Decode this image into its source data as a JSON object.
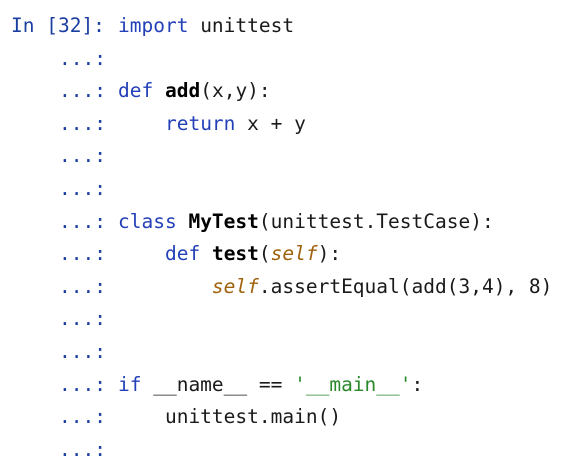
{
  "cell": {
    "in_prompt": "In [32]:",
    "cont_prompt": "...:",
    "lines": [
      {
        "tokens": [
          {
            "t": "import",
            "c": "kw"
          },
          {
            "t": " unittest",
            "c": "name"
          }
        ]
      },
      {
        "tokens": []
      },
      {
        "tokens": [
          {
            "t": "def",
            "c": "kw"
          },
          {
            "t": " ",
            "c": "name"
          },
          {
            "t": "add",
            "c": "fn"
          },
          {
            "t": "(x,y):",
            "c": "name"
          }
        ]
      },
      {
        "tokens": [
          {
            "t": "    ",
            "c": "name"
          },
          {
            "t": "return",
            "c": "kw"
          },
          {
            "t": " x + y",
            "c": "name"
          }
        ]
      },
      {
        "tokens": []
      },
      {
        "tokens": []
      },
      {
        "tokens": [
          {
            "t": "class",
            "c": "kw"
          },
          {
            "t": " ",
            "c": "name"
          },
          {
            "t": "MyTest",
            "c": "cls"
          },
          {
            "t": "(unittest.TestCase):",
            "c": "name"
          }
        ]
      },
      {
        "tokens": [
          {
            "t": "    ",
            "c": "name"
          },
          {
            "t": "def",
            "c": "kw"
          },
          {
            "t": " ",
            "c": "name"
          },
          {
            "t": "test",
            "c": "fn"
          },
          {
            "t": "(",
            "c": "name"
          },
          {
            "t": "self",
            "c": "selfkw"
          },
          {
            "t": "):",
            "c": "name"
          }
        ]
      },
      {
        "tokens": [
          {
            "t": "        ",
            "c": "name"
          },
          {
            "t": "self",
            "c": "selfkw"
          },
          {
            "t": ".assertEqual(add(3,4), 8)",
            "c": "name"
          }
        ]
      },
      {
        "tokens": []
      },
      {
        "tokens": []
      },
      {
        "tokens": [
          {
            "t": "if",
            "c": "kw"
          },
          {
            "t": " __name__ == ",
            "c": "name"
          },
          {
            "t": "'__main__'",
            "c": "str"
          },
          {
            "t": ":",
            "c": "name"
          }
        ]
      },
      {
        "tokens": [
          {
            "t": "    unittest.main()",
            "c": "name"
          }
        ]
      },
      {
        "tokens": []
      }
    ]
  },
  "colors": {
    "background": "#ffffff",
    "prompt": "#1a3fa0",
    "keyword": "#2340b8",
    "self": "#a0620c",
    "string": "#2a8a2a",
    "text": "#1a1a1a"
  }
}
